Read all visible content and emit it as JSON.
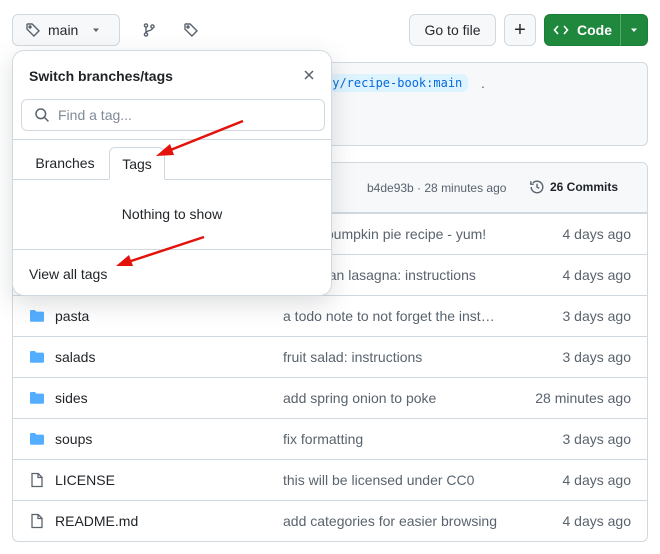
{
  "header": {
    "branch_label": "main",
    "goto_file_label": "Go to file",
    "plus_label": "+",
    "code_label": "Code"
  },
  "banner": {
    "ref_text": "ry/recipe-book:main",
    "trailing_text": "."
  },
  "commit_bar": {
    "hash_time": "b4de93b · 28 minutes ago",
    "commits_count": "26 Commits"
  },
  "files": [
    {
      "name": "",
      "message": "c pumpkin pie recipe - yum!",
      "time": "4 days ago",
      "type": "hidden"
    },
    {
      "name": "",
      "message": "rian lasagna: instructions",
      "time": "4 days ago",
      "type": "hidden"
    },
    {
      "name": "pasta",
      "message": "a todo note to not forget the inst…",
      "time": "3 days ago",
      "type": "folder"
    },
    {
      "name": "salads",
      "message": "fruit salad: instructions",
      "time": "3 days ago",
      "type": "folder"
    },
    {
      "name": "sides",
      "message": "add spring onion to poke",
      "time": "28 minutes ago",
      "type": "folder"
    },
    {
      "name": "soups",
      "message": "fix formatting",
      "time": "3 days ago",
      "type": "folder"
    },
    {
      "name": "LICENSE",
      "message": "this will be licensed under CC0",
      "time": "4 days ago",
      "type": "file"
    },
    {
      "name": "README.md",
      "message": "add categories for easier browsing",
      "time": "4 days ago",
      "type": "file"
    }
  ],
  "popover": {
    "title": "Switch branches/tags",
    "search_placeholder": "Find a tag...",
    "tabs": [
      "Branches",
      "Tags"
    ],
    "active_tab": "Tags",
    "empty_text": "Nothing to show",
    "view_all_label": "View all tags"
  },
  "colors": {
    "accent_green": "#1f883d",
    "folder_blue": "#54aeff",
    "link_blue": "#0969da",
    "annotation_red": "#e3120b"
  },
  "icons": [
    "tag-icon",
    "chevron-down-icon",
    "git-branch-icon",
    "code-icon",
    "history-icon",
    "folder-icon",
    "file-icon",
    "search-icon",
    "close-icon"
  ]
}
